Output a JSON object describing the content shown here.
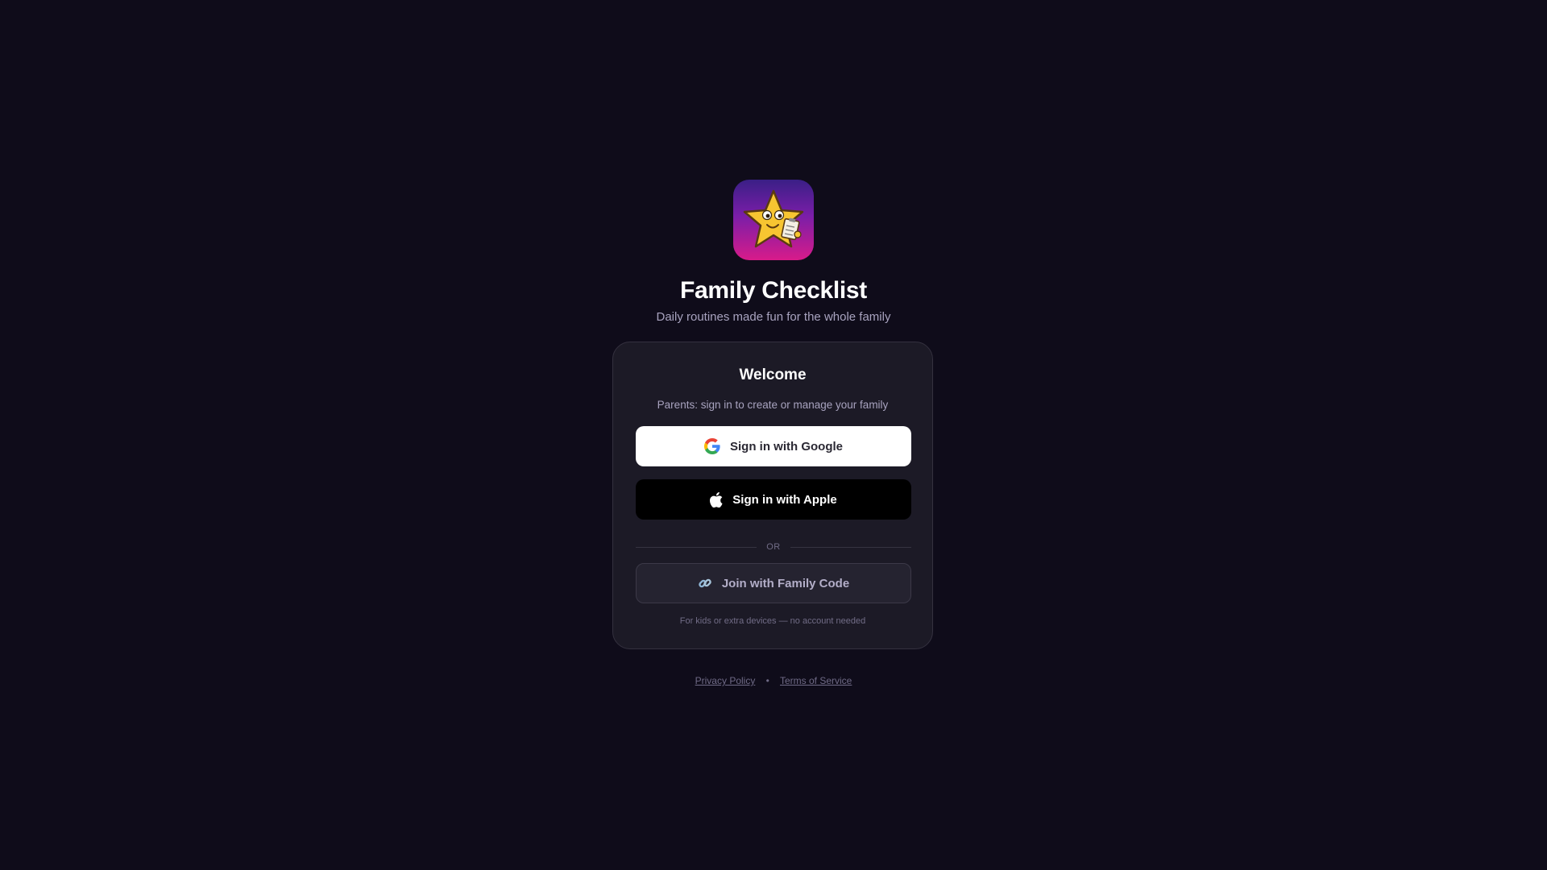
{
  "app": {
    "title": "Family Checklist",
    "subtitle": "Daily routines made fun for the whole family",
    "logo_icon": "star-mascot-icon"
  },
  "card": {
    "title": "Welcome",
    "text": "Parents: sign in to create or manage your family",
    "google_label": "Sign in with Google",
    "apple_label": "Sign in with Apple",
    "divider_label": "OR",
    "family_code_label": "Join with Family Code",
    "footnote": "For kids or extra devices — no account needed"
  },
  "footer": {
    "privacy_label": "Privacy Policy",
    "separator": "•",
    "terms_label": "Terms of Service"
  },
  "colors": {
    "background": "#0f0c1a",
    "card": "#1c1a26",
    "logo_gradient_top": "#3a1f86",
    "logo_gradient_bottom": "#d81b8a",
    "star": "#f7c531"
  }
}
